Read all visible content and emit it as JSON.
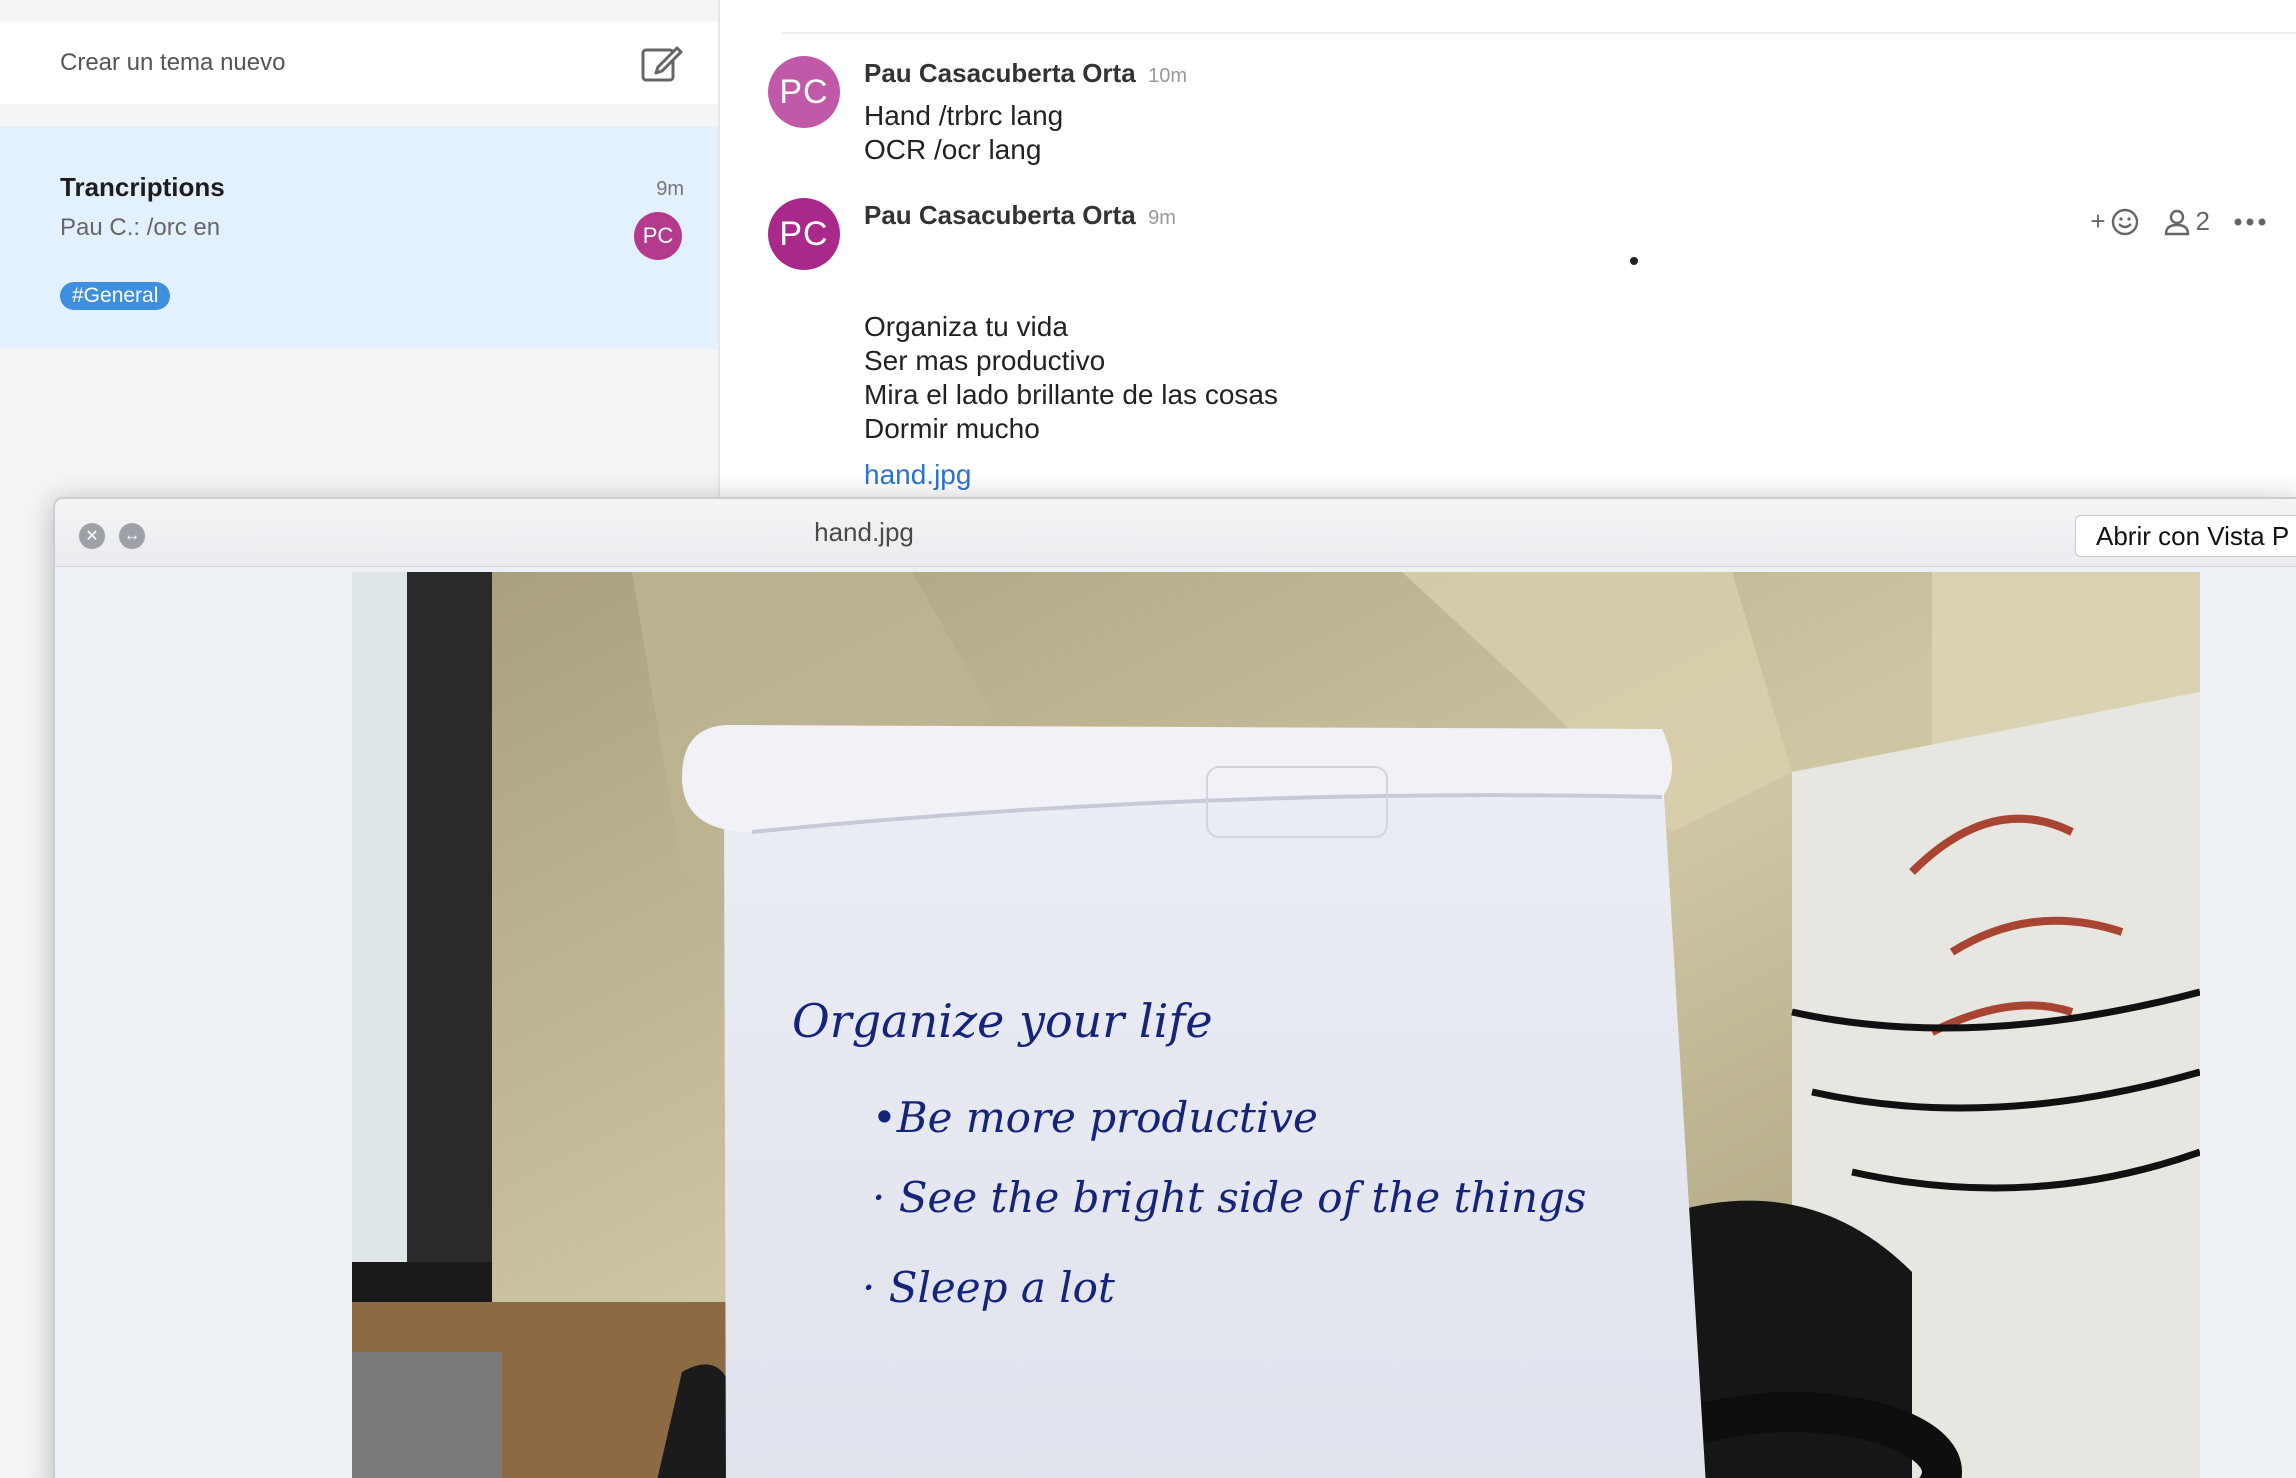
{
  "sidebar": {
    "new_topic_label": "Crear un tema nuevo",
    "new_topic_icon": "compose-icon",
    "thread": {
      "title": "Trancriptions",
      "time": "9m",
      "preview": "Pau C.: /orc en",
      "avatar_initials": "PC",
      "tag": "#General"
    }
  },
  "chat": {
    "messages": [
      {
        "avatar_initials": "PC",
        "author": "Pau Casacuberta Orta",
        "time": "10m",
        "lines": [
          "Hand /trbrc lang",
          "OCR /ocr lang"
        ]
      },
      {
        "avatar_initials": "PC",
        "author": "Pau Casacuberta Orta",
        "time": "9m",
        "lines": [
          "Organiza tu vida",
          "Ser mas productivo",
          "Mira el lado brillante de las cosas",
          "Dormir mucho"
        ],
        "attachment": "hand.jpg",
        "actions": {
          "reaction_icon": "add-reaction-icon",
          "reaction_label": "+",
          "participants_icon": "person-icon",
          "participants_count": "2",
          "more_icon": "more-icon"
        }
      }
    ]
  },
  "quicklook": {
    "title": "hand.jpg",
    "open_button": "Abrir con Vista P",
    "close_icon": "close-icon",
    "fullscreen_icon": "fullscreen-icon",
    "photo": {
      "note_lines": [
        "Organize your life",
        "•Be more productive",
        "· See the bright side of the things",
        "· Sleep a lot"
      ]
    }
  },
  "colors": {
    "selected_thread_bg": "#e3f0fd",
    "tag_bg": "#3e8fe0",
    "avatar_primary": "#a8298a",
    "link": "#2a74d6"
  }
}
